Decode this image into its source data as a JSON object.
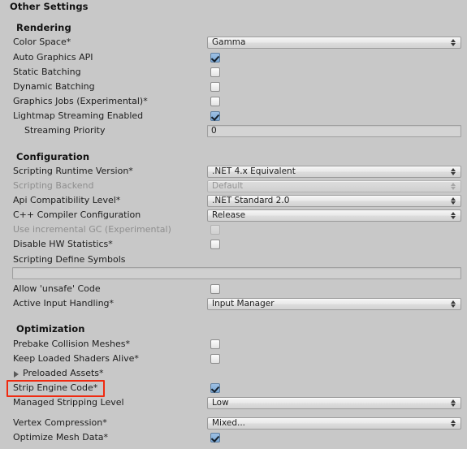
{
  "panel": {
    "title": "Other Settings",
    "background_color": "#c8c8c8",
    "highlight_color": "#f02a10"
  },
  "sections": {
    "rendering": {
      "title": "Rendering",
      "rows": {
        "color_space": {
          "label": "Color Space*",
          "value": "Gamma"
        },
        "auto_graphics_api": {
          "label": "Auto Graphics API",
          "value": "checked"
        },
        "static_batching": {
          "label": "Static Batching",
          "value": "unchecked"
        },
        "dynamic_batching": {
          "label": "Dynamic Batching",
          "value": "unchecked"
        },
        "graphics_jobs": {
          "label": "Graphics Jobs (Experimental)*",
          "value": "unchecked"
        },
        "lightmap_streaming_enabled": {
          "label": "Lightmap Streaming Enabled",
          "value": "checked"
        },
        "streaming_priority": {
          "label": "Streaming Priority",
          "value": "0"
        }
      }
    },
    "configuration": {
      "title": "Configuration",
      "rows": {
        "scripting_runtime_version": {
          "label": "Scripting Runtime Version*",
          "value": ".NET 4.x Equivalent"
        },
        "scripting_backend": {
          "label": "Scripting Backend",
          "value": "Default"
        },
        "api_compatibility_level": {
          "label": "Api Compatibility Level*",
          "value": ".NET Standard 2.0"
        },
        "cpp_compiler_configuration": {
          "label": "C++ Compiler Configuration",
          "value": "Release"
        },
        "use_incremental_gc": {
          "label": "Use incremental GC (Experimental)",
          "value": "unchecked"
        },
        "disable_hw_statistics": {
          "label": "Disable HW Statistics*",
          "value": "unchecked"
        },
        "scripting_define_symbols": {
          "label": "Scripting Define Symbols",
          "value": ""
        },
        "allow_unsafe_code": {
          "label": "Allow 'unsafe' Code",
          "value": "unchecked"
        },
        "active_input_handling": {
          "label": "Active Input Handling*",
          "value": "Input Manager"
        }
      }
    },
    "optimization": {
      "title": "Optimization",
      "rows": {
        "prebake_collision_meshes": {
          "label": "Prebake Collision Meshes*",
          "value": "unchecked"
        },
        "keep_loaded_shaders_alive": {
          "label": "Keep Loaded Shaders Alive*",
          "value": "unchecked"
        },
        "preloaded_assets": {
          "label": "Preloaded Assets*",
          "value": "collapsed"
        },
        "strip_engine_code": {
          "label": "Strip Engine Code*",
          "value": "checked"
        },
        "managed_stripping_level": {
          "label": "Managed Stripping Level",
          "value": "Low"
        },
        "vertex_compression": {
          "label": "Vertex Compression*",
          "value": "Mixed..."
        },
        "optimize_mesh_data": {
          "label": "Optimize Mesh Data*",
          "value": "checked"
        }
      }
    }
  }
}
